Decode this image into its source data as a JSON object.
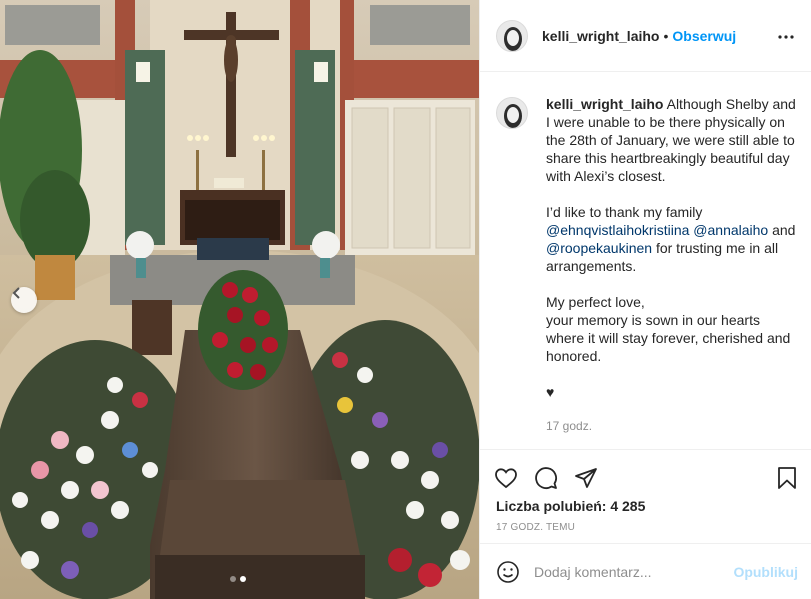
{
  "post": {
    "username": "kelli_wright_laiho",
    "follow_label": "Obserwuj",
    "separator": "•",
    "caption": {
      "username": "kelli_wright_laiho",
      "paragraph1": "Although Shelby and I were unable to be there physically on the 28th of January, we were still able to share this heartbreakingly beautiful day with Alexi’s closest.",
      "paragraph2_start": "I’d like to thank my family",
      "mention1": "@ehnqvistlaihokristiina",
      "mention2": "@annalaiho",
      "and_word": "and",
      "mention3": "@roopekaukinen",
      "paragraph2_end": "for trusting me in all arrangements.",
      "paragraph3_line1": "My perfect love,",
      "paragraph3_line2": "your memory is sown in our hearts where it will stay forever, cherished and honored.",
      "heart": "♥",
      "time": "17 godz."
    },
    "likes_text": "Liczba polubień: 4 285",
    "time_ago": "17 GODZ. TEMU",
    "comment_placeholder": "Dodaj komentarz...",
    "publish_label": "Opublikuj"
  },
  "carousel": {
    "total": 2,
    "active": 2
  },
  "icons": {
    "heart": "heart-icon",
    "comment": "comment-icon",
    "share": "paper-plane-icon",
    "save": "bookmark-icon",
    "emoji": "emoji-icon",
    "more": "more-icon",
    "prev": "chevron-left-icon"
  },
  "colors": {
    "follow": "#0095f6",
    "publish_disabled": "#b2dffc",
    "mention": "#00376b",
    "muted": "#8e8e8e"
  }
}
